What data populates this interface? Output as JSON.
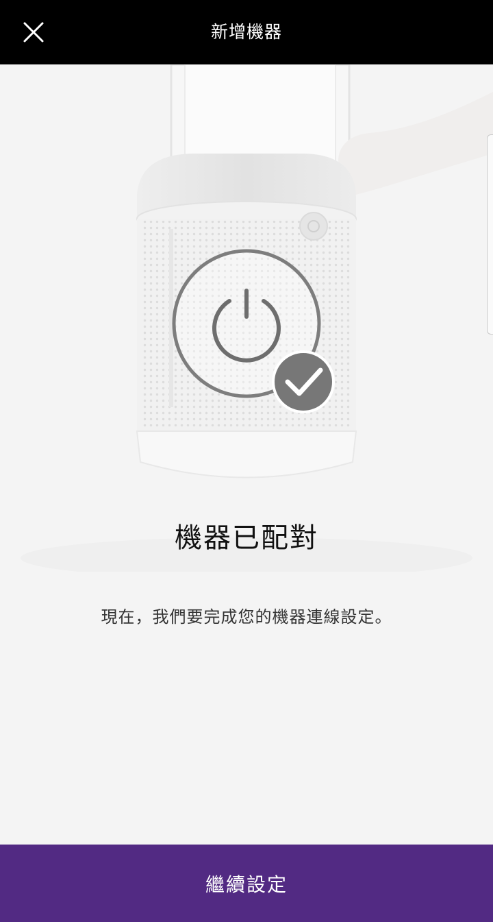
{
  "header": {
    "title": "新增機器",
    "close_icon": "close-icon"
  },
  "hero": {
    "illustration": "purifier-fan-illustration",
    "status_icon": "power-icon",
    "badge_icon": "checkmark-icon"
  },
  "main": {
    "heading": "機器已配對",
    "description": "現在，我們要完成您的機器連線設定。"
  },
  "footer": {
    "continue_label": "繼續設定"
  },
  "colors": {
    "header_bg": "#000000",
    "page_bg": "#f4f4f4",
    "accent": "#522a83",
    "icon_gray": "#6e6e6e"
  }
}
